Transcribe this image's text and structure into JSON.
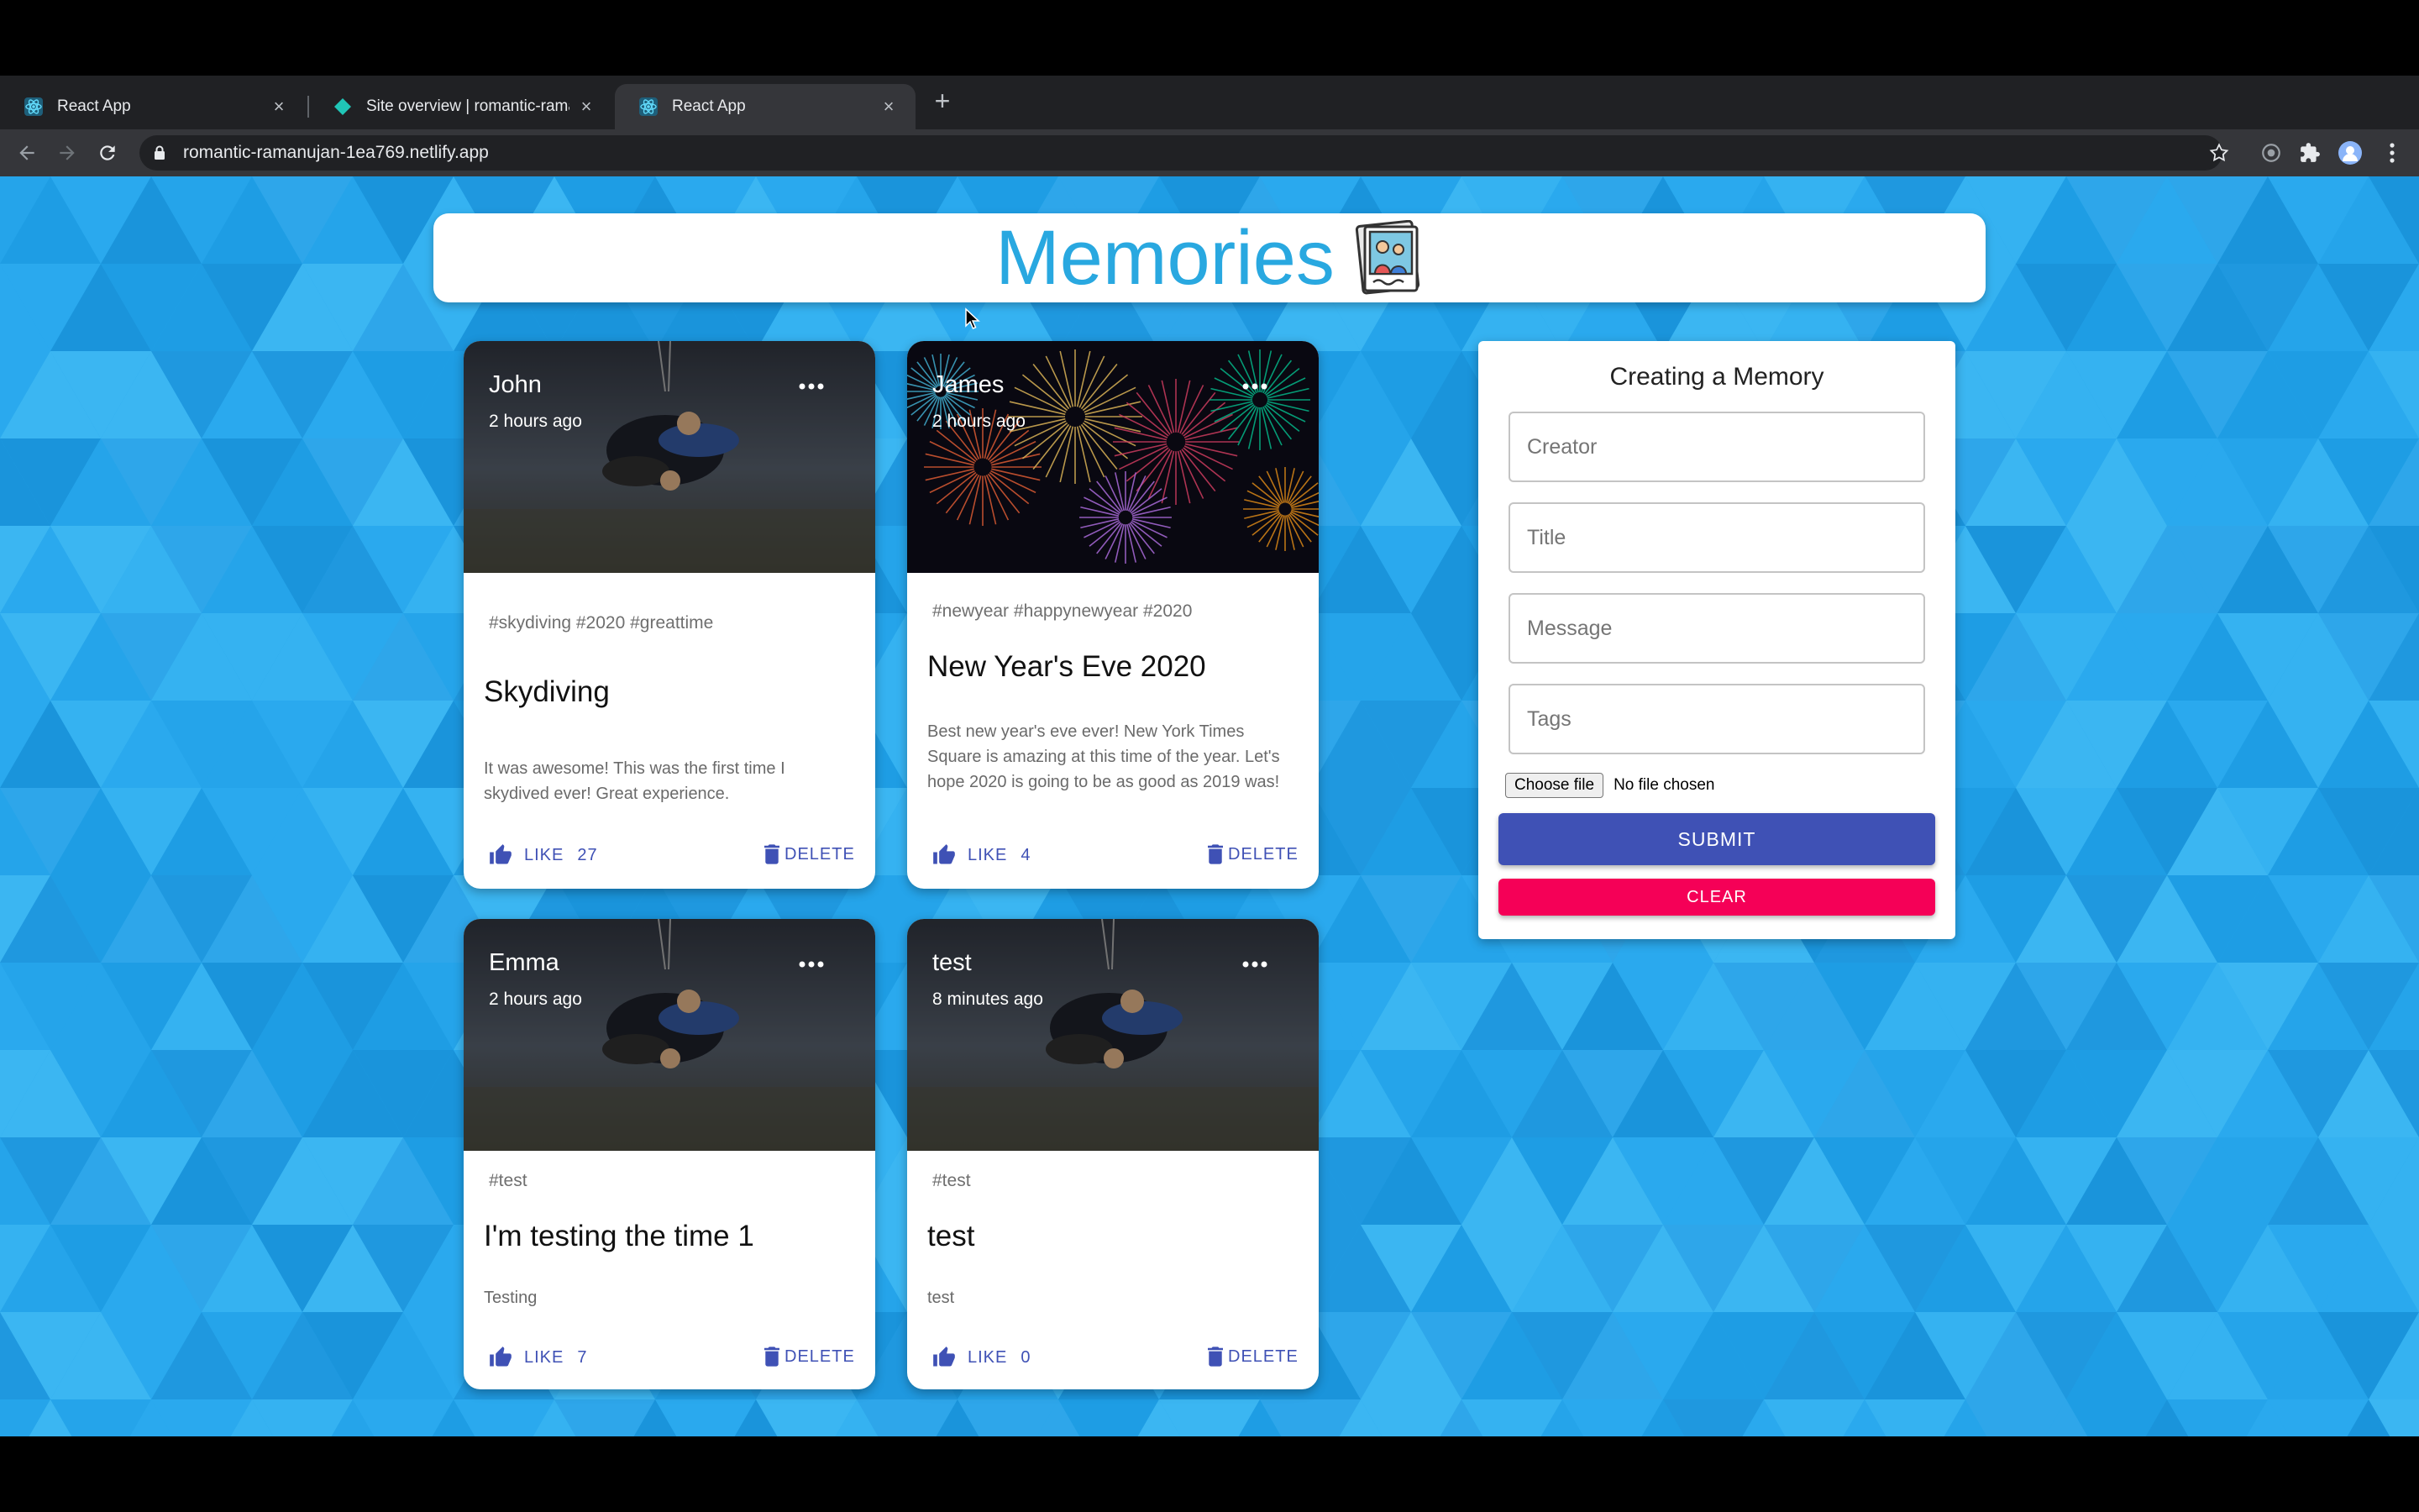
{
  "browser": {
    "tabs": [
      {
        "title": "React App",
        "favicon": "react-icon",
        "active": false
      },
      {
        "title": "Site overview | romantic-raman",
        "favicon": "netlify-icon",
        "active": false
      },
      {
        "title": "React App",
        "favicon": "react-icon",
        "active": true
      }
    ],
    "url": "romantic-ramanujan-1ea769.netlify.app"
  },
  "app": {
    "title": "Memories",
    "logo": "memories-photo-icon",
    "background_color": "#29a8ec"
  },
  "posts": [
    {
      "creator": "John",
      "time": "2 hours ago",
      "image": "skydiving-photo",
      "tags": "#skydiving #2020 #greattime",
      "title": "Skydiving",
      "message": "It was awesome! This was the first time I skydived ever! Great experience.",
      "like_label": "LIKE",
      "like_count": "27",
      "delete_label": "DELETE"
    },
    {
      "creator": "James",
      "time": "2 hours ago",
      "image": "fireworks-photo",
      "tags": "#newyear #happynewyear #2020",
      "title": "New Year's Eve 2020",
      "message": "Best new year's eve ever! New York Times Square is amazing at this time of the year. Let's hope 2020 is going to be as good as 2019 was!",
      "like_label": "LIKE",
      "like_count": "4",
      "delete_label": "DELETE"
    },
    {
      "creator": "Emma",
      "time": "2 hours ago",
      "image": "skydiving-photo",
      "tags": "#test",
      "title": "I'm testing the time 1",
      "message": "Testing",
      "like_label": "LIKE",
      "like_count": "7",
      "delete_label": "DELETE"
    },
    {
      "creator": "test",
      "time": "8 minutes ago",
      "image": "skydiving-photo",
      "tags": "#test",
      "title": "test",
      "message": "test",
      "like_label": "LIKE",
      "like_count": "0",
      "delete_label": "DELETE"
    }
  ],
  "form": {
    "title": "Creating a Memory",
    "fields": [
      {
        "placeholder": "Creator",
        "value": ""
      },
      {
        "placeholder": "Title",
        "value": ""
      },
      {
        "placeholder": "Message",
        "value": ""
      },
      {
        "placeholder": "Tags",
        "value": ""
      }
    ],
    "file_button": "Choose file",
    "file_status": "No file chosen",
    "submit_label": "SUBMIT",
    "clear_label": "CLEAR",
    "primary_color": "#3f51b5",
    "secondary_color": "#f50057"
  }
}
